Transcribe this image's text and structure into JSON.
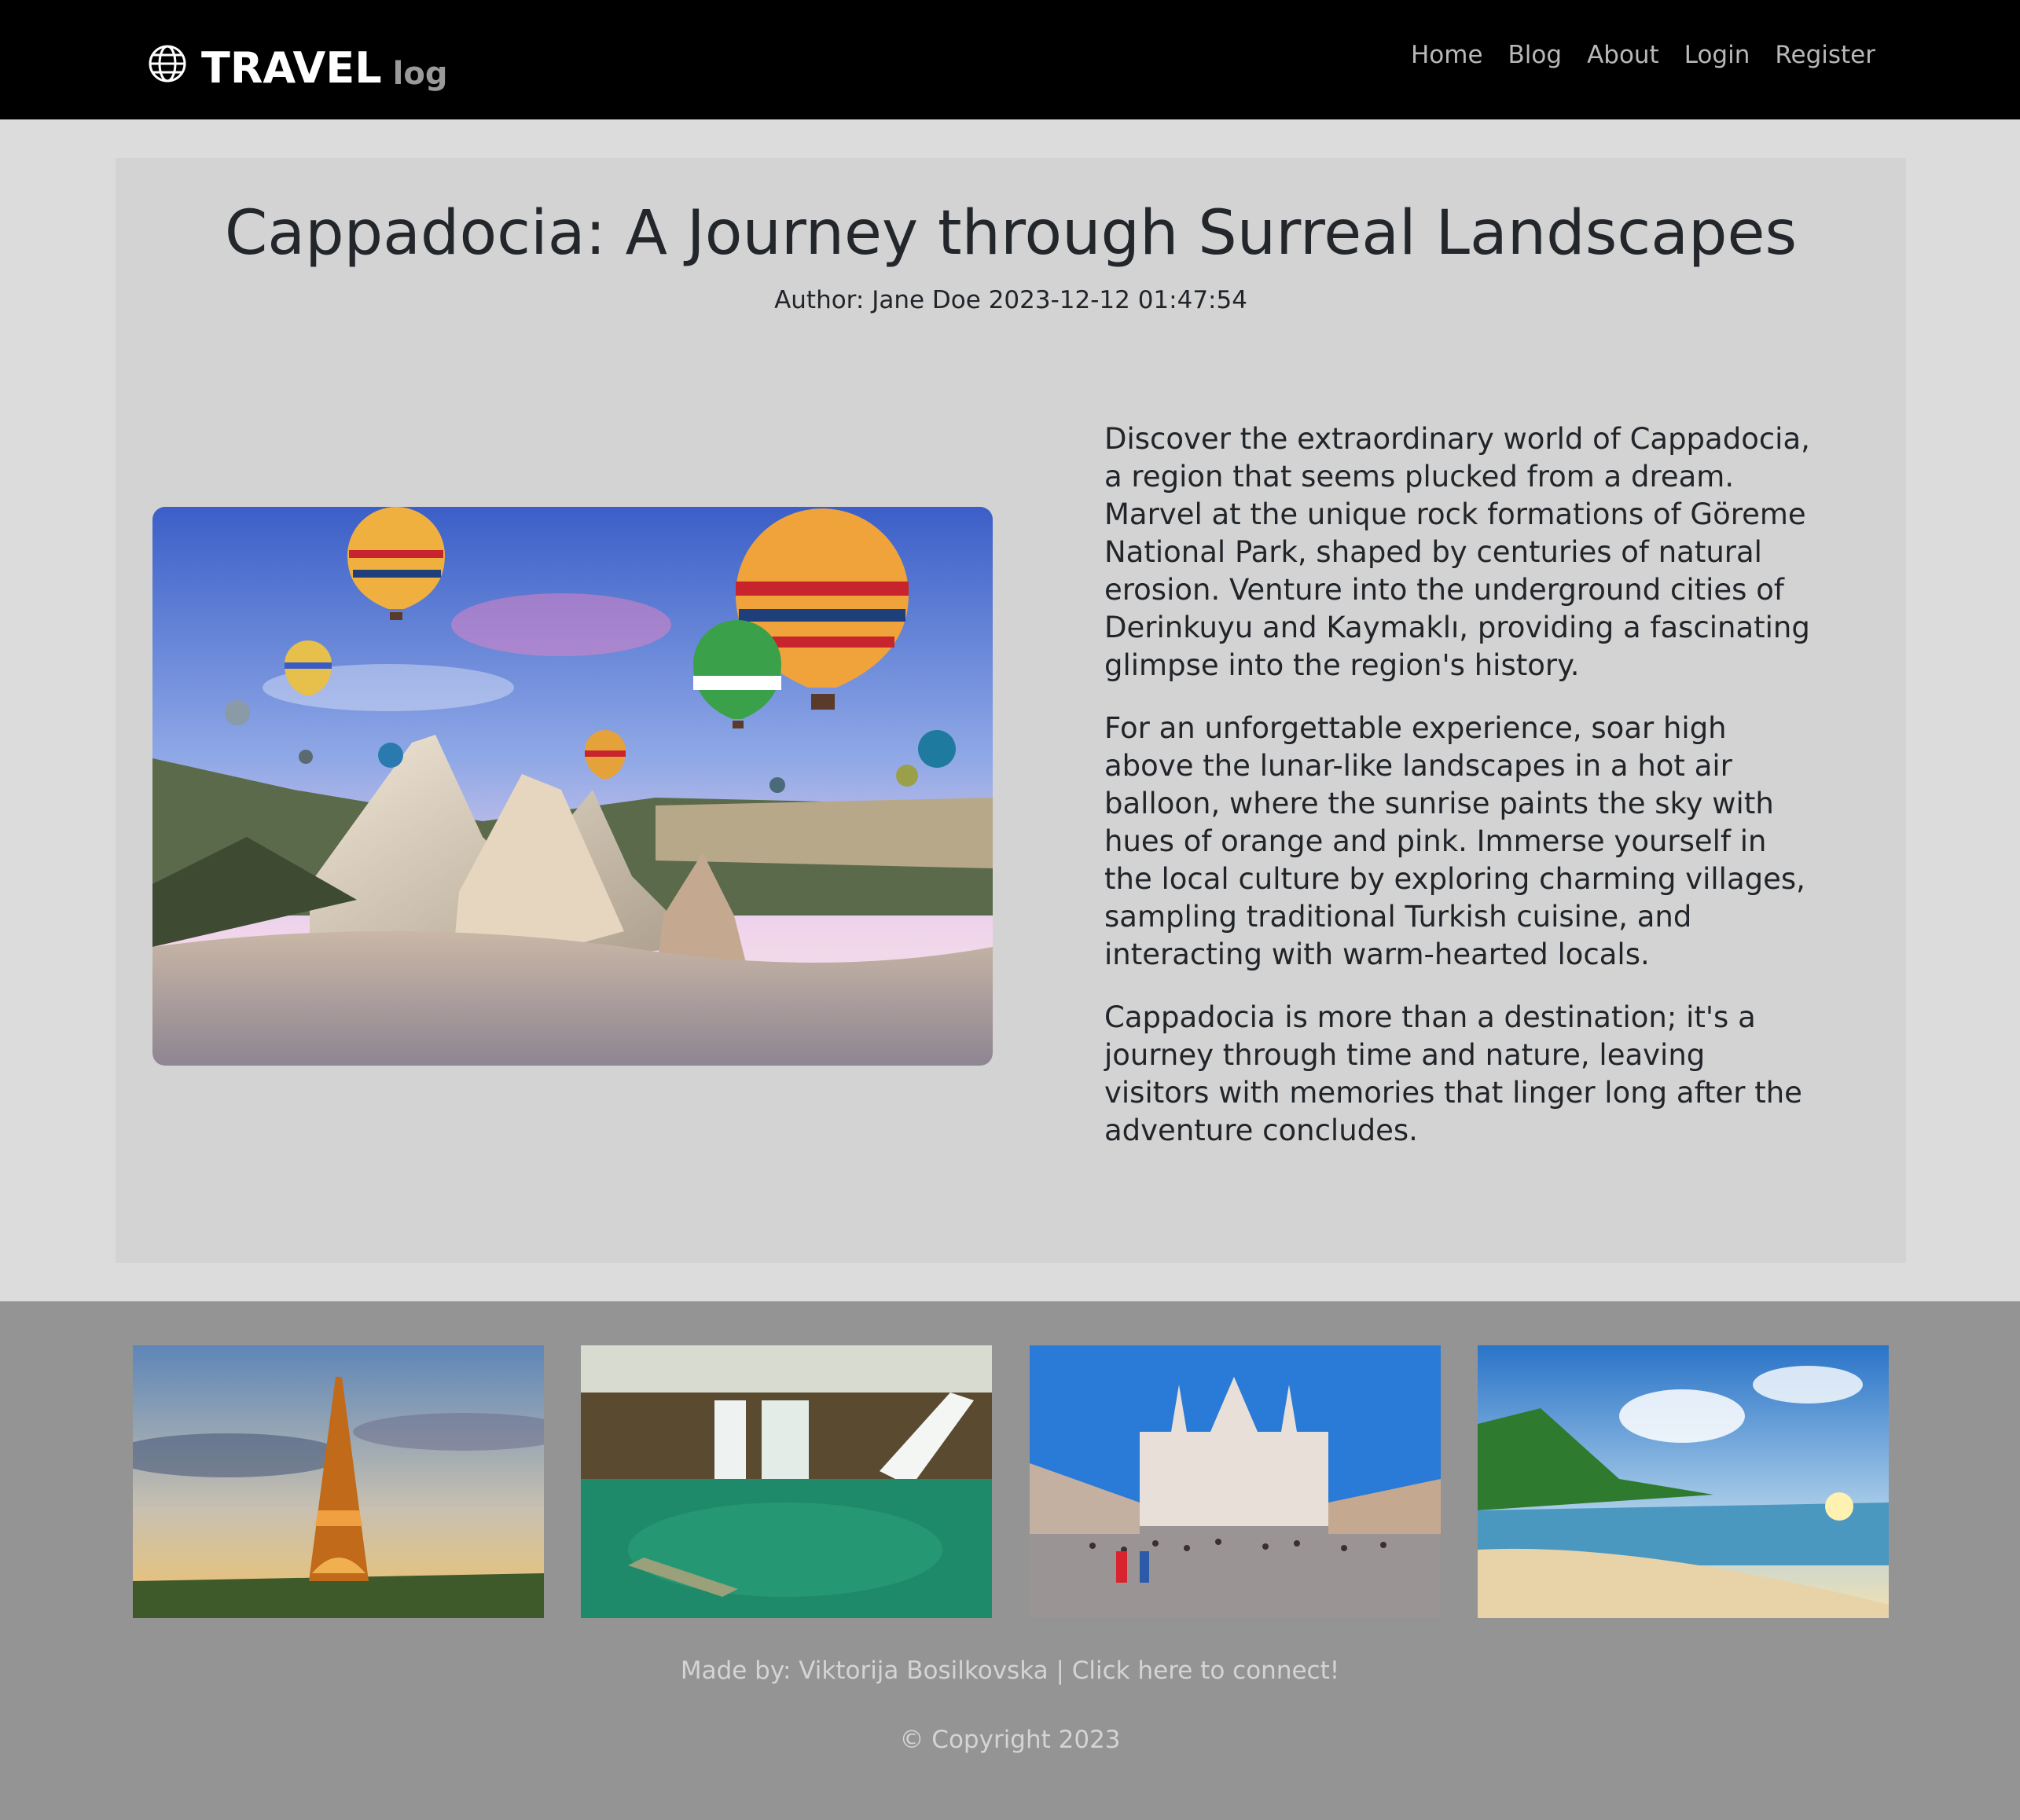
{
  "brand": {
    "name": "TRAVEL",
    "suffix": "log",
    "icon": "globe-icon"
  },
  "nav": {
    "home": "Home",
    "blog": "Blog",
    "about": "About",
    "login": "Login",
    "register": "Register"
  },
  "post": {
    "title": "Cappadocia: A Journey through Surreal Landscapes",
    "author_label": "Author:",
    "author": "Jane Doe",
    "date": "2023-12-12 01:47:54",
    "paragraphs": [
      "Discover the extraordinary world of Cappadocia, a region that seems plucked from a dream. Marvel at the unique rock formations of Göreme National Park, shaped by centuries of natural erosion. Venture into the underground cities of Derinkuyu and Kaymaklı, providing a fascinating glimpse into the region's history.",
      "For an unforgettable experience, soar high above the lunar-like landscapes in a hot air balloon, where the sunrise paints the sky with hues of orange and pink. Immerse yourself in the local culture by exploring charming villages, sampling traditional Turkish cuisine, and interacting with warm-hearted locals.",
      "Cappadocia is more than a destination; it's a journey through time and nature, leaving visitors with memories that linger long after the adventure concludes."
    ]
  },
  "footer": {
    "credit_text": "Made by: Viktorija Bosilkovska | Click here to connect!",
    "copyright": "© Copyright 2023"
  },
  "colors": {
    "navbar": "#000000",
    "page": "#dcdcdc",
    "card": "#d3d3d3",
    "footer": "#949494"
  }
}
